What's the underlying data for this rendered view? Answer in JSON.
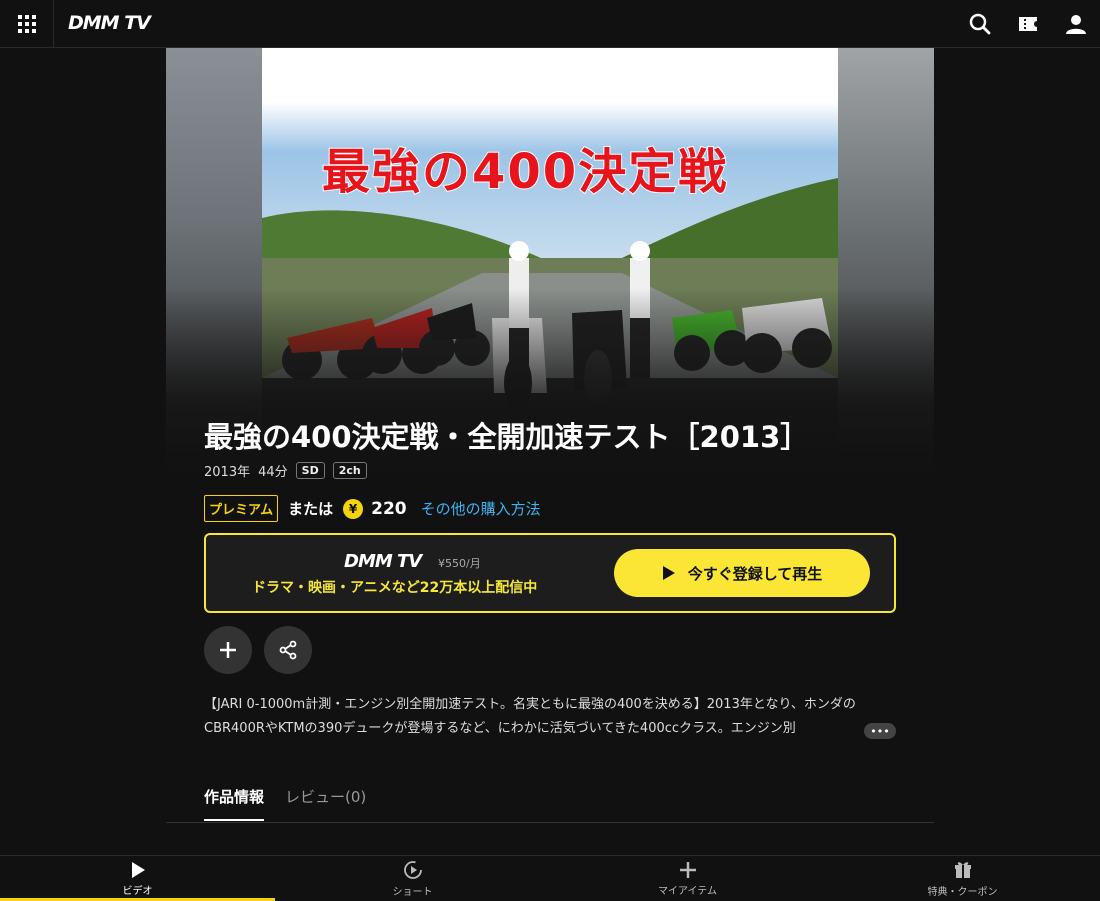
{
  "header": {
    "logo": "DMM TV",
    "icons": [
      "grid-menu-icon",
      "search-icon",
      "ticket-icon",
      "user-icon"
    ]
  },
  "hero": {
    "thumbnail_title": "最強の400決定戦"
  },
  "video": {
    "title": "最強の400決定戦・全開加速テスト［2013］",
    "year": "2013年",
    "duration": "44分",
    "tags": [
      "SD",
      "2ch"
    ]
  },
  "pricing": {
    "premium_label": "プレミアム",
    "or_label": "または",
    "yen_symbol": "¥",
    "price": "220",
    "other_methods": "その他の購入方法"
  },
  "promo": {
    "logo": "DMM TV",
    "price": "¥550/月",
    "text": "ドラマ・映画・アニメなど22万本以上配信中",
    "cta": "今すぐ登録して再生",
    "border_color": "#f5e63a",
    "button_color": "#fbe635"
  },
  "actions": [
    "add-icon",
    "share-icon"
  ],
  "description": {
    "text": "【JARI 0-1000m計測・エンジン別全開加速テスト。名実ともに最強の400を決める】2013年となり、ホンダのCBR400RやKTMの390デュークが登場するなど、にわかに活気づいてきた400ccクラス。エンジン別",
    "more": "•••"
  },
  "tabs": [
    {
      "label": "作品情報",
      "active": true
    },
    {
      "label": "レビュー(0)",
      "active": false
    }
  ],
  "bottom_nav": [
    {
      "label": "ビデオ",
      "icon": "play-icon",
      "active": true
    },
    {
      "label": "ショート",
      "icon": "short-icon",
      "active": false
    },
    {
      "label": "マイアイテム",
      "icon": "plus-icon",
      "active": false
    },
    {
      "label": "特典・クーポン",
      "icon": "gift-icon",
      "active": false
    }
  ],
  "colors": {
    "accent": "#f5d40b",
    "link": "#3ab4f2",
    "background": "#111111"
  }
}
